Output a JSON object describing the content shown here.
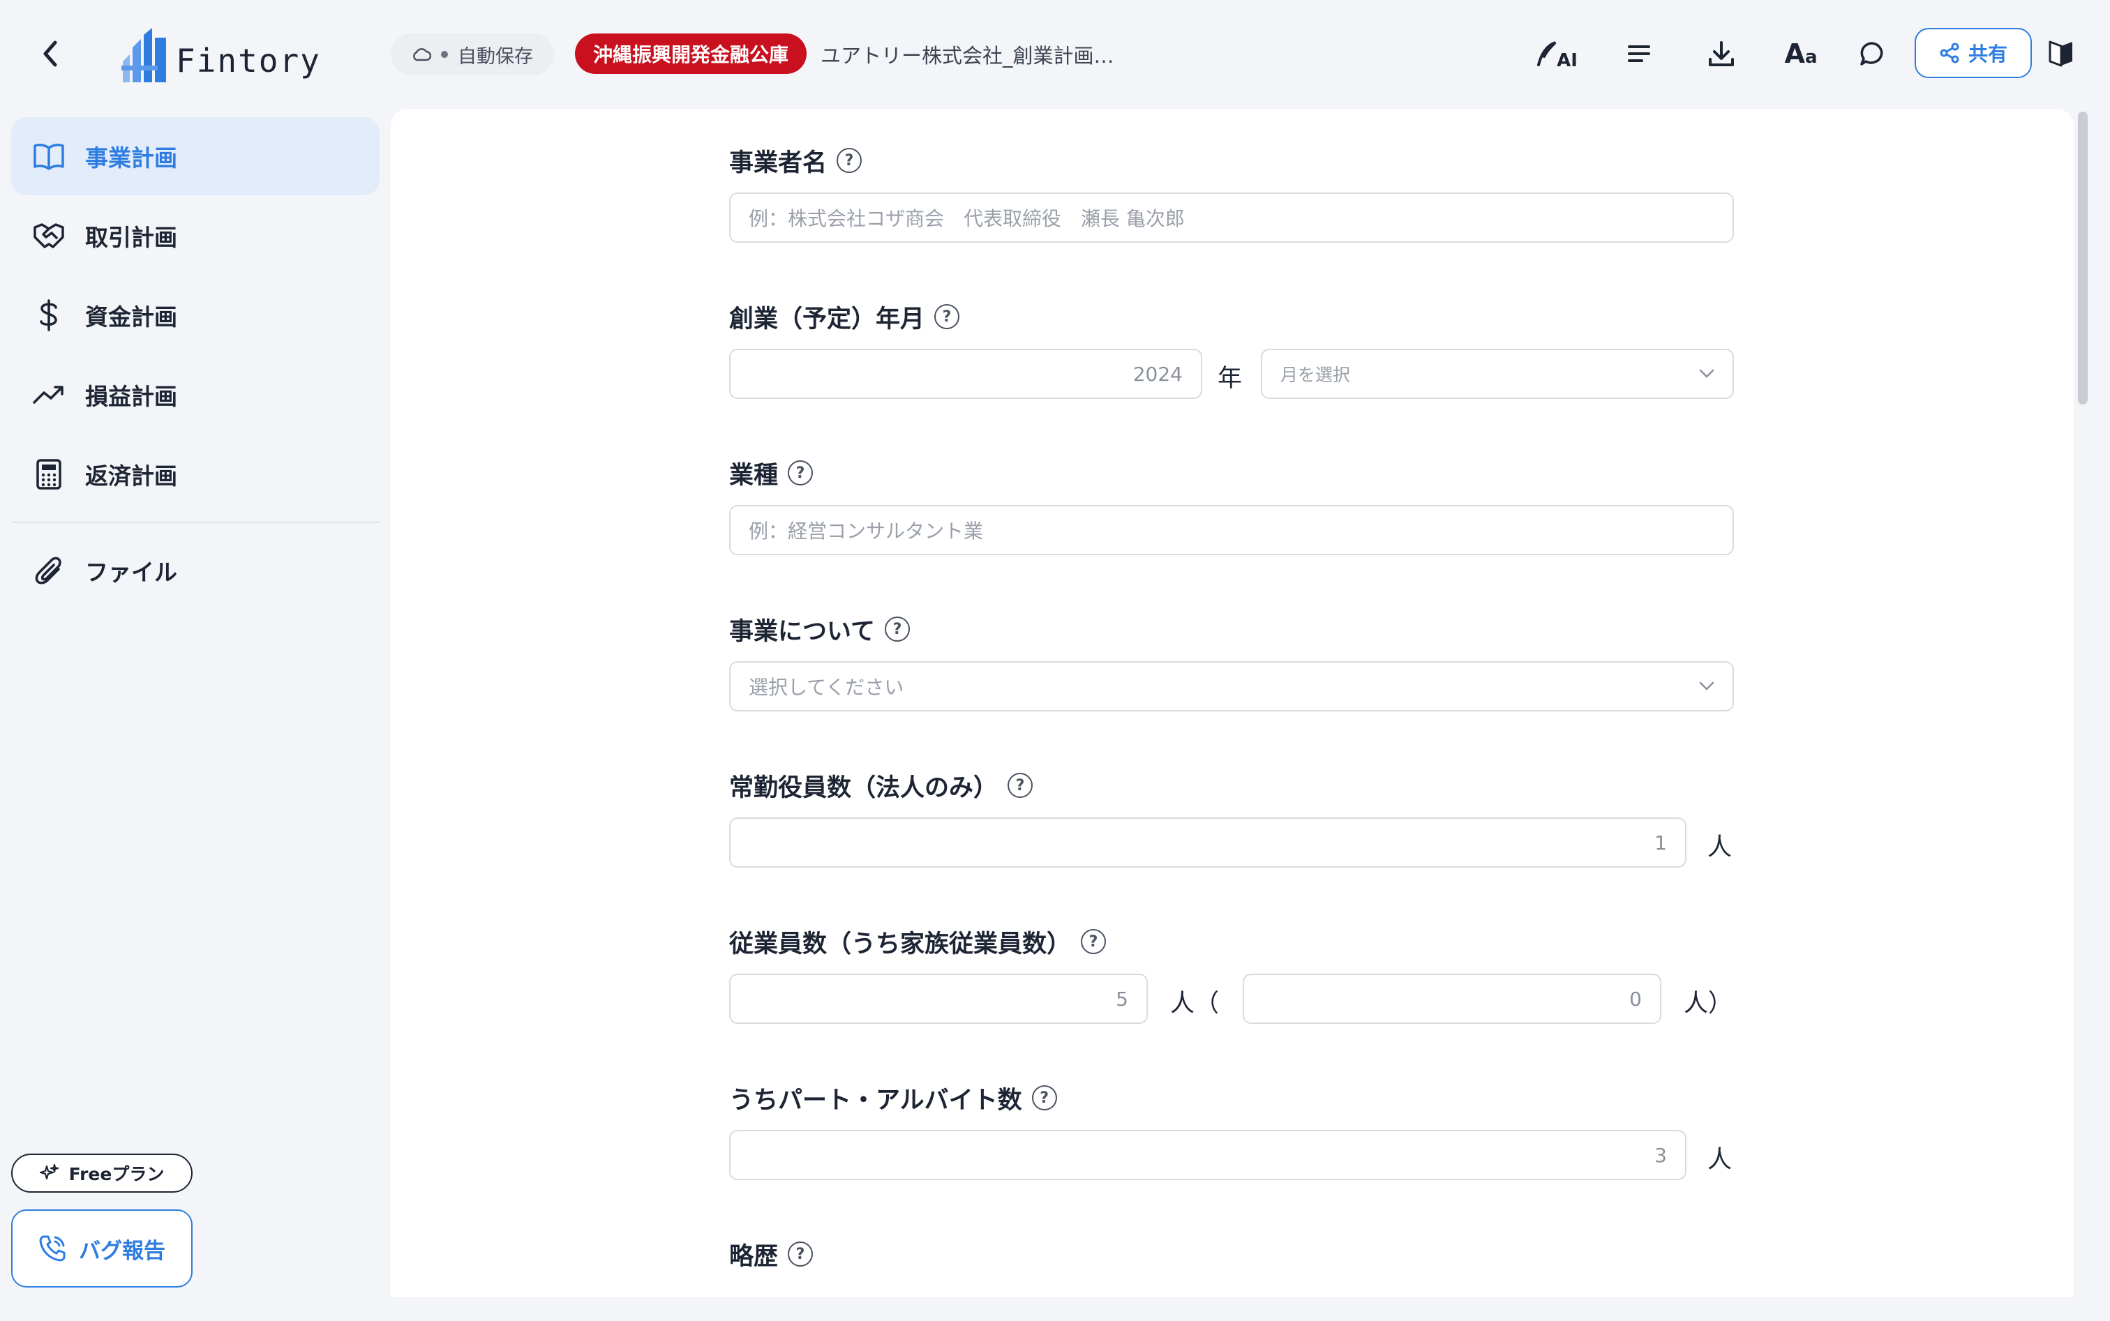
{
  "header": {
    "logo_text": "Fintory",
    "autosave_label": "自動保存",
    "lender_badge": "沖縄振興開発金融公庫",
    "document_title": "ユアトリー株式会社_創業計画…",
    "ai_label": "AI",
    "font_label_large": "A",
    "font_label_small": "a",
    "share_label": "共有"
  },
  "sidebar": {
    "items": [
      {
        "label": "事業計画",
        "icon": "book-icon",
        "active": true
      },
      {
        "label": "取引計画",
        "icon": "handshake-icon",
        "active": false
      },
      {
        "label": "資金計画",
        "icon": "dollar-icon",
        "active": false
      },
      {
        "label": "損益計画",
        "icon": "trending-up-icon",
        "active": false
      },
      {
        "label": "返済計画",
        "icon": "calculator-icon",
        "active": false
      },
      {
        "label": "ファイル",
        "icon": "paperclip-icon",
        "active": false
      }
    ],
    "plan_label": "Freeプラン",
    "bug_report_label": "バグ報告"
  },
  "form": {
    "business_owner": {
      "label": "事業者名",
      "placeholder": "例：株式会社コザ商会　代表取締役　瀬長 亀次郎"
    },
    "founding_date": {
      "label": "創業（予定）年月",
      "year_value": "2024",
      "year_unit": "年",
      "month_placeholder": "月を選択"
    },
    "industry": {
      "label": "業種",
      "placeholder": "例：経営コンサルタント業"
    },
    "business_about": {
      "label": "事業について",
      "placeholder": "選択してください"
    },
    "directors": {
      "label": "常勤役員数（法人のみ）",
      "value": "1",
      "unit": "人"
    },
    "employees": {
      "label": "従業員数（うち家族従業員数）",
      "value": "5",
      "unit_open": "人（",
      "family_value": "0",
      "unit_close": "人）"
    },
    "part_time": {
      "label": "うちパート・アルバイト数",
      "value": "3",
      "unit": "人"
    },
    "history": {
      "label": "略歴"
    }
  },
  "help_glyph": "?",
  "colors": {
    "accent": "#2f7de1",
    "lender_badge_bg": "#c8101e",
    "active_nav_bg": "#e2ecfb"
  }
}
